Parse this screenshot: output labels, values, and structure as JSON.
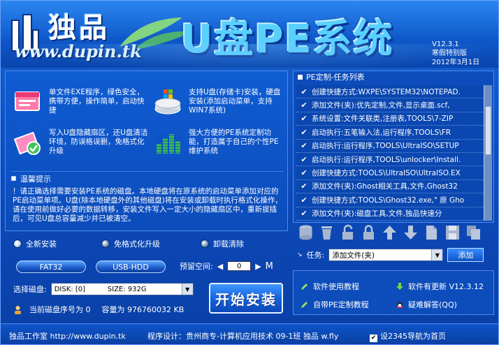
{
  "header": {
    "logo_title": "独品",
    "logo_url": "www.dupin.tk",
    "app_title": "U盘PE系统",
    "version": "V12.3.1",
    "edition": "寒假特别版",
    "date": "2012年3月1日"
  },
  "features": [
    {
      "icon": "exe-window-icon",
      "text": "单文件EXE程序，绿色安全，携带方便，操作简单，启动快捷"
    },
    {
      "icon": "drive-install-icon",
      "text": "支持U盘(存储卡)安装，硬盘安装(添加启动菜单，支持WIN7系统)"
    },
    {
      "icon": "usb-hidden-icon",
      "text": "写入U盘隐藏扇区，还U盘清洁环境，防误格误删，免格式化升级"
    },
    {
      "icon": "pe-custom-icon",
      "text": "强大方便的PE系统定制功能，打造属于自己的个性PE维护系统"
    }
  ],
  "tips": {
    "title": "温馨提示",
    "body": "！请正确选择需要安装PE系统的磁盘。本地硬盘将在原系统的启动菜单添加对应的PE启动菜单项。U盘(除本地硬盘外的其他磁盘)将在安装或卸载时执行格式化操作，请在使用前做好必要的数据转移，安装文件写入一定大小的隐藏扇区中，重新拔插后，可见U盘总容量减少并已被清空。"
  },
  "install": {
    "modes": [
      {
        "label": "全新安装",
        "selected": true
      },
      {
        "label": "免格式化升级",
        "selected": false
      },
      {
        "label": "卸载清除",
        "selected": false
      }
    ],
    "fs_button": "FAT32",
    "mode_button": "USB-HDD",
    "reserve_label": "预留空间:",
    "reserve_value": "0",
    "reserve_unit": "M",
    "disk_label": "选择磁盘:",
    "disk_value": "DISK: [0]          SIZE: 932G",
    "disk_number_label": "当前磁盘序号为 0",
    "capacity_label": "容量为 976760032 KB",
    "start_button": "开始安装"
  },
  "task_panel": {
    "title": "PE定制-任务列表",
    "items": [
      "创建快捷方式:WXPE\\SYSTEM32\\NOTEPAD.",
      "添加文件(夹):优先定制,文件,显示桌面.scf,",
      "系统设置:文件关联类,注册表,TOOLS\\7-ZIP",
      "启动执行:五笔输入法,运行程序,TOOLS\\FR",
      "启动执行:运行程序,TOOLS\\UltraISO\\SETUP",
      "启动执行:运行程序,TOOLS\\unlocker\\Install.",
      "创建快捷方式:TOOLS\\UltraISO\\UltraISO.EX",
      "添加文件(夹):Ghost相关工具,文件,Ghost32",
      "创建快捷方式:TOOLS\\Ghost32.exe,\" 原 Gho",
      "添加文件(夹):磁盘工具,文件,独品快速分"
    ],
    "task_label": "任务:",
    "task_value": "添加文件(夹)",
    "add_button": "添加"
  },
  "links": {
    "tutorial": "软件使用教程",
    "update": "软件有更新 V12.3.12",
    "pe_tutorial": "自带PE定制教程",
    "faq": "疑难解答(QQ)"
  },
  "status": {
    "studio": "独品工作室 http://www.dupin.tk",
    "designer": "程序设计：贵州商专-计算机应用技术 09-1班 独品 w.fly",
    "homepage_checkbox": "设2345导航为首页"
  },
  "colors": {
    "background": "#0d4ec0",
    "accent": "#5ad0ff",
    "panel_border": "#4b8df0"
  }
}
